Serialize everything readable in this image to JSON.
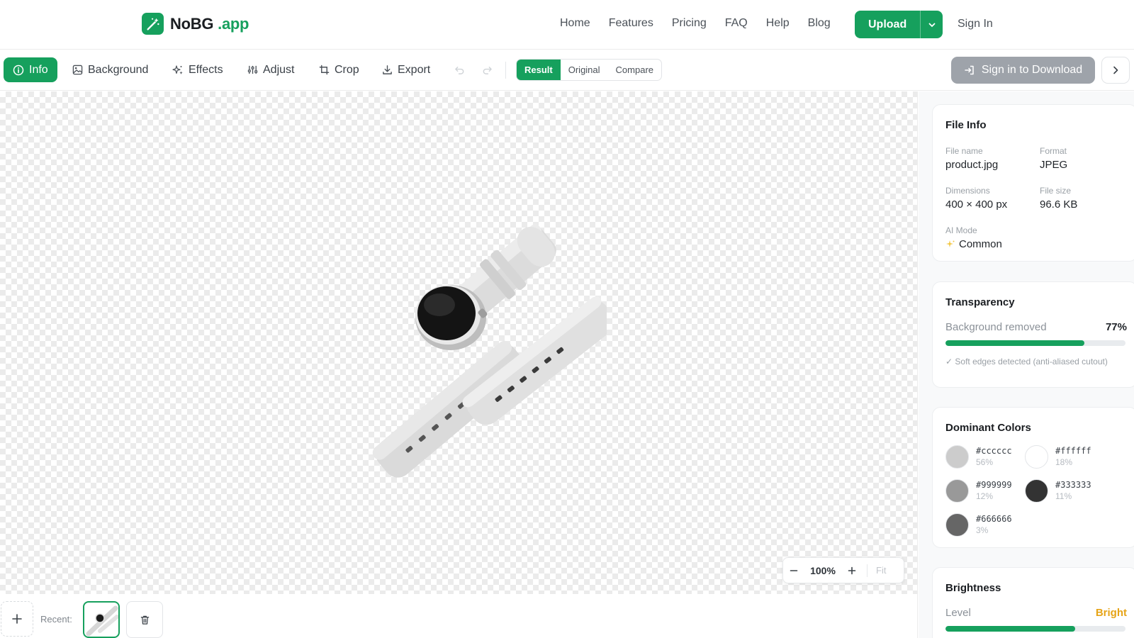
{
  "app": {
    "logo_name": "NoBG",
    "logo_suffix": ".app",
    "brand_color": "#16a05d"
  },
  "nav": {
    "links": [
      "Home",
      "Features",
      "Pricing",
      "FAQ",
      "Help",
      "Blog"
    ],
    "upload_label": "Upload",
    "signin_label": "Sign In"
  },
  "toolbar": {
    "tools": [
      {
        "label": "Info",
        "icon": "info-icon",
        "active": true
      },
      {
        "label": "Background",
        "icon": "image-icon"
      },
      {
        "label": "Effects",
        "icon": "sparkles-icon"
      },
      {
        "label": "Adjust",
        "icon": "sliders-icon"
      },
      {
        "label": "Crop",
        "icon": "crop-icon"
      },
      {
        "label": "Export",
        "icon": "download-icon"
      }
    ],
    "view_modes": [
      "Result",
      "Original",
      "Compare"
    ],
    "active_view": "Result",
    "download_label": "Sign in to Download"
  },
  "canvas": {
    "zoom": "100%",
    "fit_label": "Fit"
  },
  "bottom": {
    "recent_label": "Recent:"
  },
  "file_info": {
    "title": "File Info",
    "file_name_label": "File name",
    "file_name": "product.jpg",
    "format_label": "Format",
    "format": "JPEG",
    "dimensions_label": "Dimensions",
    "dimensions": "400 × 400 px",
    "file_size_label": "File size",
    "file_size": "96.6 KB",
    "ai_mode_label": "AI Mode",
    "ai_mode": "Common"
  },
  "transparency": {
    "title": "Transparency",
    "label": "Background removed",
    "value": "77%",
    "fraction": 0.77,
    "note": "✓ Soft edges detected (anti-aliased cutout)"
  },
  "dominant_colors": {
    "title": "Dominant Colors",
    "colors": [
      {
        "hex": "#cccccc",
        "pct": "56%"
      },
      {
        "hex": "#ffffff",
        "pct": "18%"
      },
      {
        "hex": "#999999",
        "pct": "12%"
      },
      {
        "hex": "#333333",
        "pct": "11%"
      },
      {
        "hex": "#666666",
        "pct": "3%"
      }
    ]
  },
  "brightness": {
    "title": "Brightness",
    "label": "Level",
    "value": "Bright",
    "fraction": 0.72
  }
}
